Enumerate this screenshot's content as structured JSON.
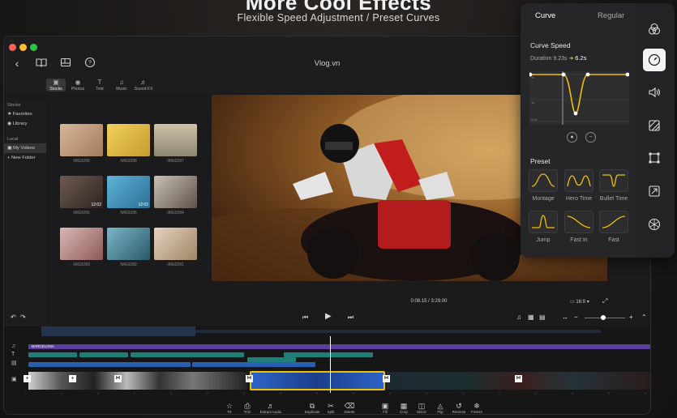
{
  "hero": {
    "title": "More Cool Effects",
    "subtitle": "Flexible Speed Adjustment / Preset Curves"
  },
  "window": {
    "title": "Vlog.vn",
    "toolbar_icons": [
      "back-icon",
      "book-icon",
      "layout-icon",
      "help-icon"
    ]
  },
  "media_tabs": [
    {
      "label": "Stocks",
      "icon": "film-icon"
    },
    {
      "label": "Photos",
      "icon": "photo-icon"
    },
    {
      "label": "Text",
      "icon": "text-icon"
    },
    {
      "label": "Music",
      "icon": "music-icon"
    },
    {
      "label": "Sound FX",
      "icon": "sound-icon"
    }
  ],
  "sidebar": {
    "stocks_header": "Stocks",
    "stocks_items": [
      "Favorites",
      "Library"
    ],
    "local_header": "Local",
    "local_items": [
      "My Videos",
      "New Folder"
    ]
  },
  "thumbnails": [
    {
      "label": "IMG0289",
      "duration": ""
    },
    {
      "label": "IMG0288",
      "duration": ""
    },
    {
      "label": "IMG0287",
      "duration": ""
    },
    {
      "label": "IMG0286",
      "duration": "12:02"
    },
    {
      "label": "IMG0285",
      "duration": "12:02"
    },
    {
      "label": "IMG0284",
      "duration": ""
    },
    {
      "label": "IMG0283",
      "duration": ""
    },
    {
      "label": "IMG0282",
      "duration": ""
    },
    {
      "label": "IMG0281",
      "duration": ""
    }
  ],
  "player": {
    "time": "0:08.15 / 3:29.00",
    "aspect": "16:9"
  },
  "timeline": {
    "text_clip": "BARCELONA",
    "bottom_tools": [
      {
        "label": "Fit",
        "icon": "star-icon"
      },
      {
        "label": "Trim",
        "icon": "trim-icon"
      },
      {
        "label": "Extract Audio",
        "icon": "audio-icon"
      },
      {
        "label": "Duplicate",
        "icon": "duplicate-icon"
      },
      {
        "label": "Split",
        "icon": "scissors-icon"
      },
      {
        "label": "Delete",
        "icon": "trash-icon"
      },
      {
        "label": "Fill",
        "icon": "fill-icon"
      },
      {
        "label": "Crop",
        "icon": "crop-icon"
      },
      {
        "label": "Mirror",
        "icon": "mirror-icon"
      },
      {
        "label": "Flip",
        "icon": "flip-icon"
      },
      {
        "label": "Reverse",
        "icon": "reverse-icon"
      },
      {
        "label": "Freeze",
        "icon": "freeze-icon"
      }
    ]
  },
  "speed_panel": {
    "tab_curve": "Curve",
    "tab_regular": "Regular",
    "curve_speed_title": "Curve Speed",
    "duration_label": "Duration 9.23s",
    "duration_new": "6.2s",
    "graph_labels": [
      "5x",
      "1x",
      "0.1x"
    ],
    "preset_title": "Preset",
    "presets": [
      "Montage",
      "Hero Time",
      "Bullet Time",
      "Jump",
      "Fast In",
      "Fast"
    ],
    "accent": "#f0c000",
    "side_icons": [
      "filters-icon",
      "speed-icon",
      "volume-icon",
      "adjust-icon",
      "transform-icon",
      "resize-icon",
      "effects-icon"
    ]
  }
}
